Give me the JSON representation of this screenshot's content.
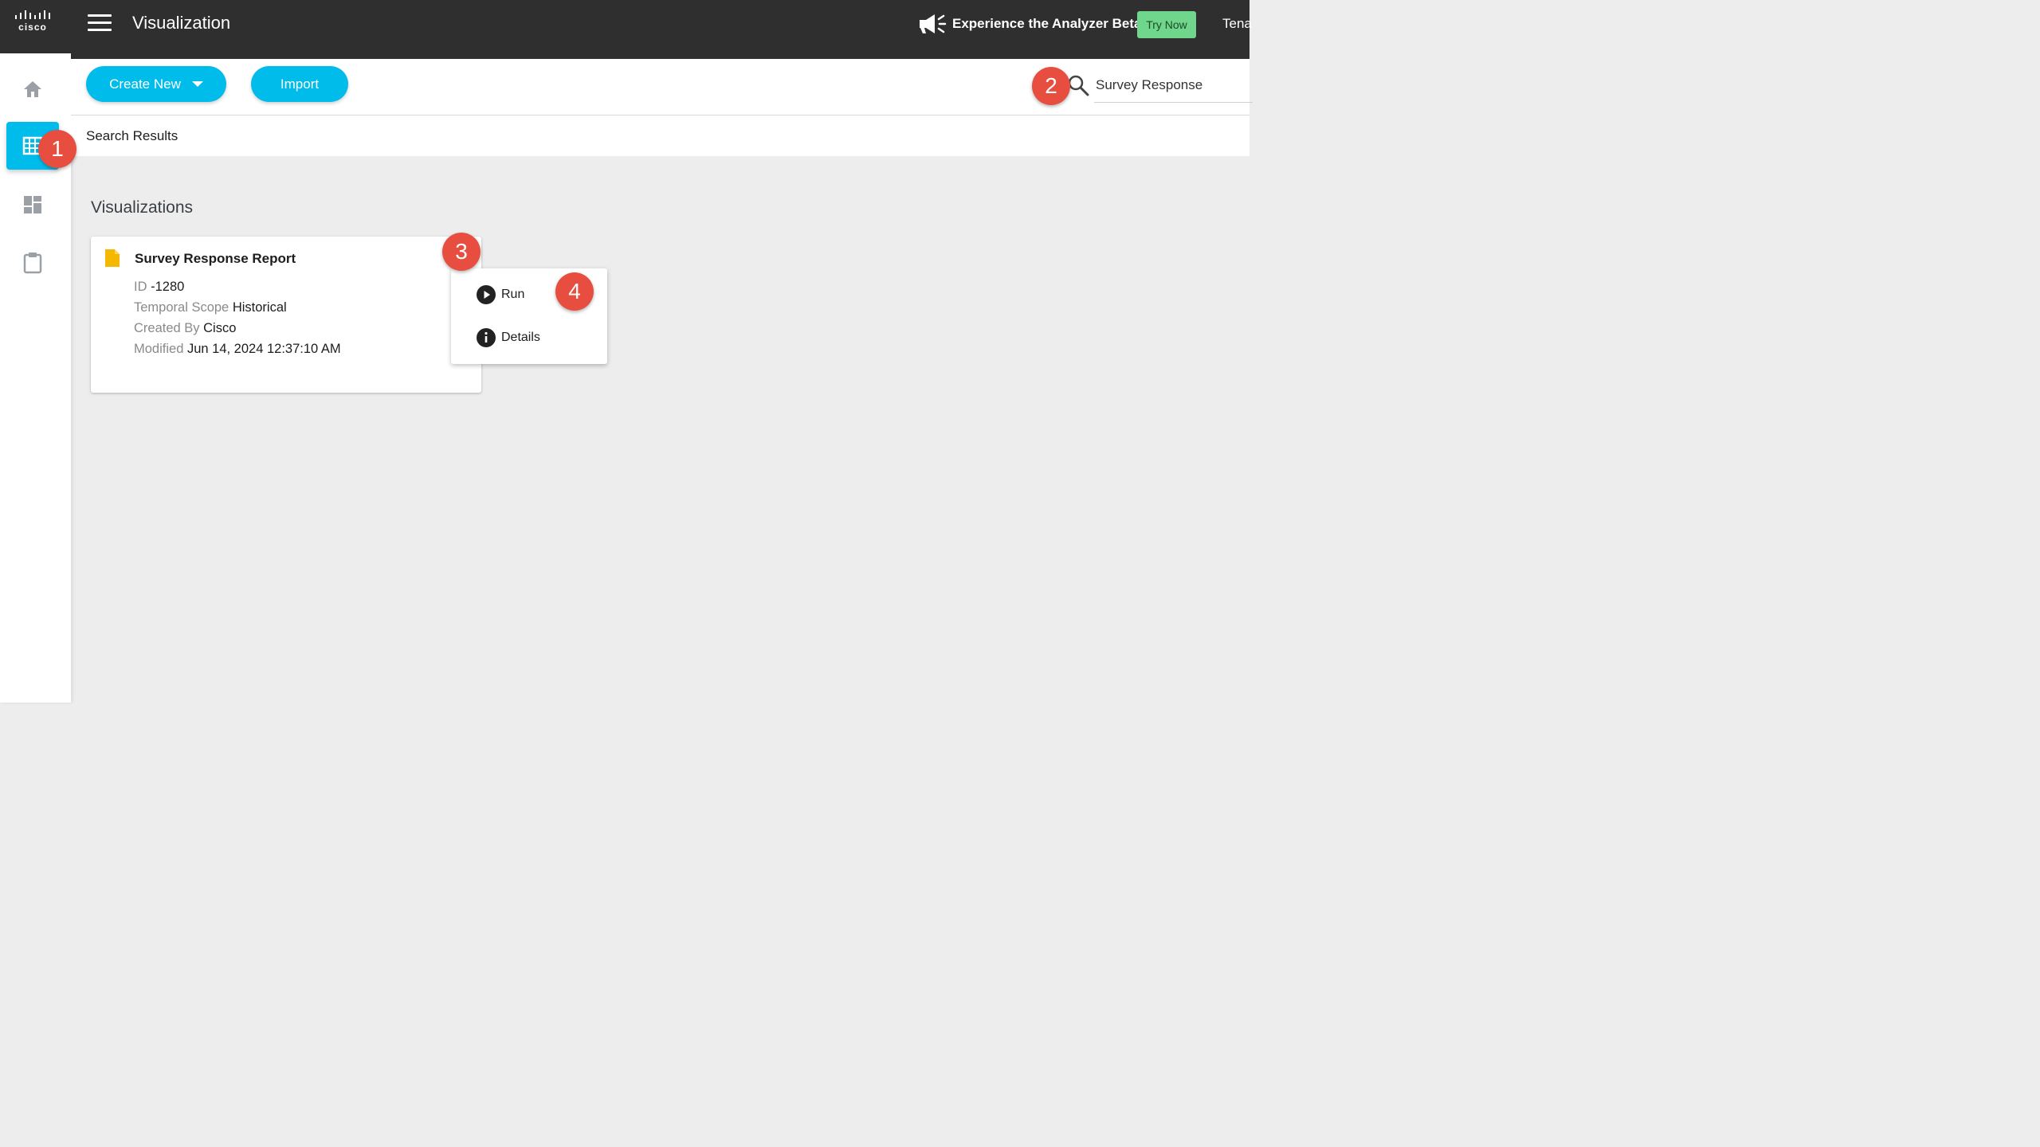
{
  "header": {
    "logo_text": "cisco",
    "app_title": "Visualization",
    "beta_text": "Experience the Analyzer Beta",
    "try_now_label": "Try Now",
    "tenant_text": "Tena"
  },
  "sidebar": {
    "items": [
      {
        "name": "home",
        "icon": "home-icon"
      },
      {
        "name": "visualizations",
        "icon": "grid-icon",
        "active": true
      },
      {
        "name": "dashboards",
        "icon": "dashboard-icon"
      },
      {
        "name": "reports",
        "icon": "clipboard-icon"
      }
    ]
  },
  "toolbar": {
    "create_new_label": "Create New",
    "import_label": "Import",
    "search_value": "Survey Response"
  },
  "results": {
    "label": "Search Results"
  },
  "content": {
    "section_title": "Visualizations",
    "card": {
      "title": "Survey Response Report",
      "id_key": "ID",
      "id_value": "-1280",
      "scope_key": "Temporal Scope",
      "scope_value": "Historical",
      "created_key": "Created By",
      "created_value": "Cisco",
      "modified_key": "Modified",
      "modified_value": "Jun 14, 2024 12:37:10 AM"
    },
    "context_menu": {
      "run_label": "Run",
      "details_label": "Details"
    }
  },
  "badges": {
    "one": "1",
    "two": "2",
    "three": "3",
    "four": "4"
  },
  "colors": {
    "accent": "#00bceb",
    "badge": "#e84e40",
    "topbar": "#2f2f2f",
    "try_now": "#6fd68b"
  }
}
